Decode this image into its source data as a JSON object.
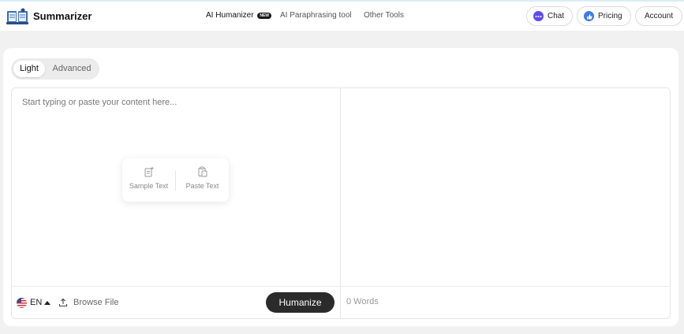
{
  "header": {
    "brand": "Summarizer",
    "nav": [
      {
        "label": "AI Humanizer",
        "badge": "NEW",
        "active": true
      },
      {
        "label": "AI Paraphrasing tool",
        "active": false
      },
      {
        "label": "Other Tools",
        "active": false
      }
    ],
    "buttons": {
      "chat": "Chat",
      "pricing": "Pricing",
      "account": "Account"
    }
  },
  "modes": {
    "light": "Light",
    "advanced": "Advanced",
    "selected": "Light"
  },
  "editor": {
    "placeholder": "Start typing or paste your content here...",
    "actions": {
      "sample": "Sample Text",
      "paste": "Paste Text"
    },
    "language": "EN",
    "browse": "Browse File",
    "submit": "Humanize",
    "word_count": "0 Words"
  },
  "colors": {
    "primary_button": "#2b2b2b",
    "chat_icon": "#5b4cf0",
    "pricing_icon": "#3d7be8"
  }
}
